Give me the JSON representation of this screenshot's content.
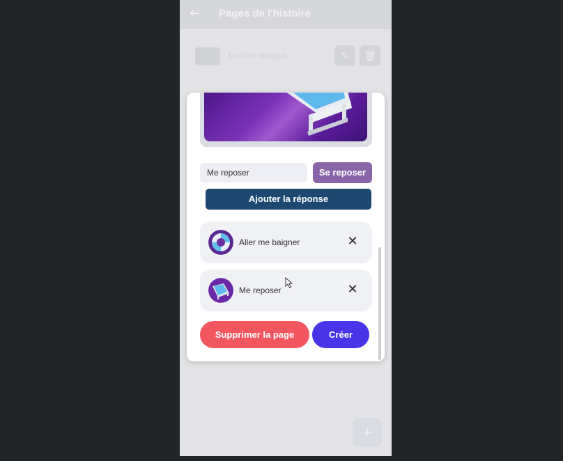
{
  "background_page": {
    "back_icon": "arrow-left-icon",
    "title": "Pages de l'histoire",
    "info_text": "Un titre masqué",
    "fab_icon": "plus-icon"
  },
  "modal": {
    "answer_input": {
      "value": "Me reposer",
      "placeholder": ""
    },
    "confirm_button": "Se reposer",
    "add_answer_button": "Ajouter la réponse",
    "answers": [
      {
        "label": "Aller me baigner",
        "icon": "swim-ring-icon"
      },
      {
        "label": "Me reposer",
        "icon": "sun-lounger-icon"
      }
    ],
    "delete_button": "Supprimer la page",
    "create_button": "Créer"
  },
  "colors": {
    "purple_button": "#8a64a8",
    "navy_button": "#1f4870",
    "delete_button": "#f2565e",
    "create_button": "#4a34e8"
  }
}
